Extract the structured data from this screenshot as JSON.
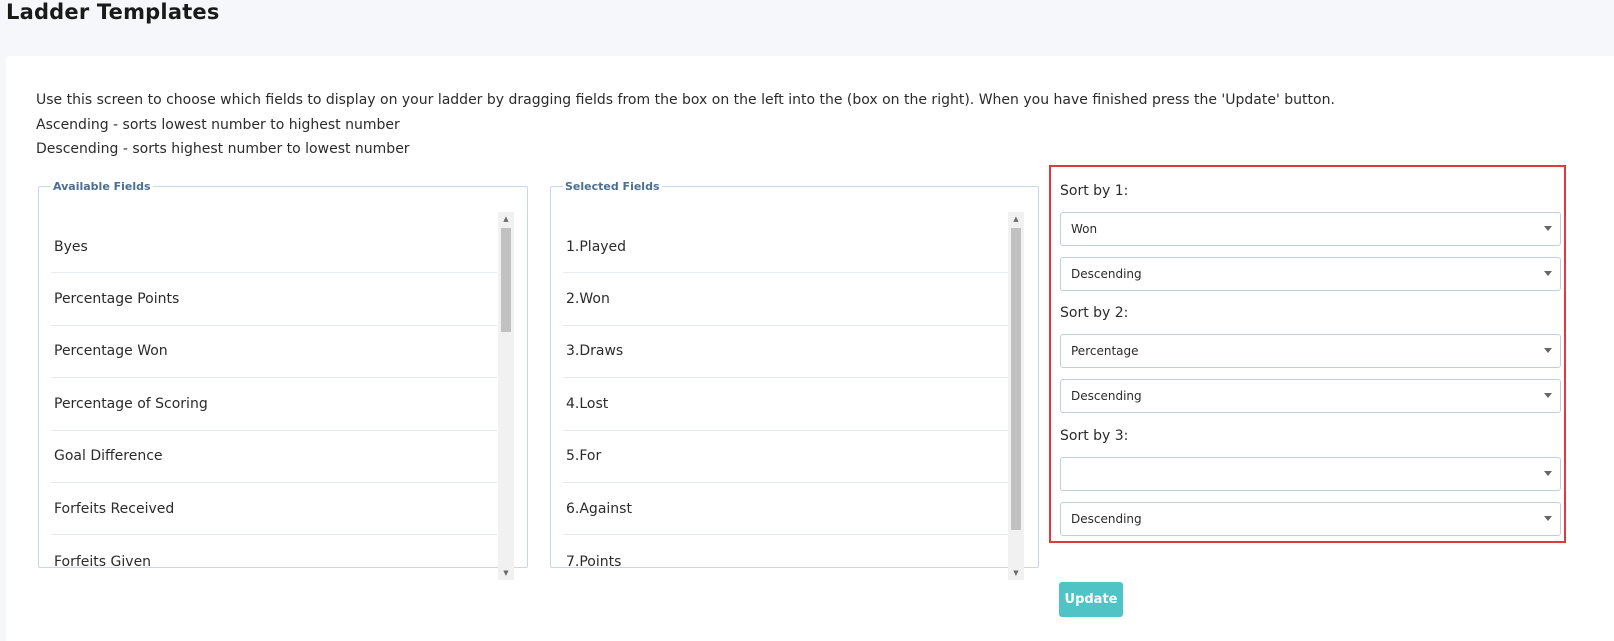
{
  "page": {
    "title": "Ladder Templates"
  },
  "instructions": [
    "Use this screen to choose which fields to display on your ladder by dragging fields from the box on the left into the (box on the right). When you have finished press the 'Update' button.",
    "Ascending - sorts lowest number to highest number",
    "Descending - sorts highest number to lowest number"
  ],
  "available_fields": {
    "legend": "Available Fields",
    "items": [
      "Byes",
      "Percentage Points",
      "Percentage Won",
      "Percentage of Scoring",
      "Goal Difference",
      "Forfeits Received",
      "Forfeits Given"
    ]
  },
  "selected_fields": {
    "legend": "Selected Fields",
    "items": [
      "1.Played",
      "2.Won",
      "3.Draws",
      "4.Lost",
      "5.For",
      "6.Against",
      "7.Points"
    ]
  },
  "sort": [
    {
      "label": "Sort by 1:",
      "field": "Won",
      "order": "Descending"
    },
    {
      "label": "Sort by 2:",
      "field": "Percentage",
      "order": "Descending"
    },
    {
      "label": "Sort by 3:",
      "field": "",
      "order": "Descending"
    }
  ],
  "actions": {
    "update_label": "Update"
  },
  "colors": {
    "accent": "#4fc3c6",
    "highlight_border": "#e0393e",
    "legend_text": "#4a6f93"
  }
}
